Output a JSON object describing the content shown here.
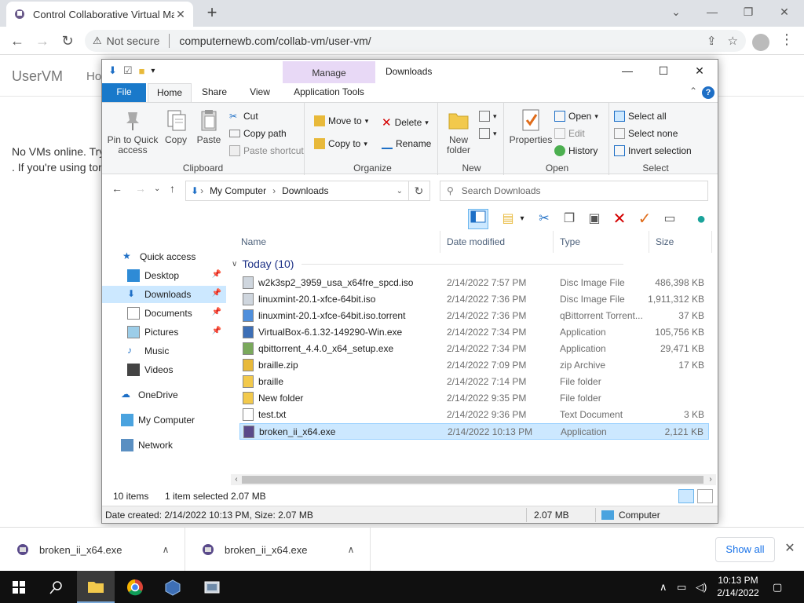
{
  "browser": {
    "tab_title": "Control Collaborative Virtual Ma",
    "security_label": "Not secure",
    "url": "computernewb.com/collab-vm/user-vm/"
  },
  "webpage": {
    "brand": "UserVM",
    "nav_link": "Ho",
    "message_line1": "No VMs online. Try",
    "message_line2": ". If you're using tor"
  },
  "explorer": {
    "window_title": "Downloads",
    "manage_label": "Manage",
    "tabs": {
      "file": "File",
      "home": "Home",
      "share": "Share",
      "view": "View",
      "app_tools": "Application Tools"
    },
    "ribbon": {
      "clipboard": {
        "label": "Clipboard",
        "pin": "Pin to Quick access",
        "copy": "Copy",
        "paste": "Paste",
        "cut": "Cut",
        "copy_path": "Copy path",
        "paste_shortcut": "Paste shortcut"
      },
      "organize": {
        "label": "Organize",
        "move_to": "Move to",
        "copy_to": "Copy to",
        "delete": "Delete",
        "rename": "Rename"
      },
      "new": {
        "label": "New",
        "new_folder": "New folder"
      },
      "open": {
        "label": "Open",
        "properties": "Properties",
        "open": "Open",
        "edit": "Edit",
        "history": "History"
      },
      "select": {
        "label": "Select",
        "select_all": "Select all",
        "select_none": "Select none",
        "invert": "Invert selection"
      }
    },
    "address": {
      "crumb1": "My Computer",
      "crumb2": "Downloads",
      "search_placeholder": "Search Downloads"
    },
    "nav": {
      "quick_access": "Quick access",
      "desktop": "Desktop",
      "downloads": "Downloads",
      "documents": "Documents",
      "pictures": "Pictures",
      "music": "Music",
      "videos": "Videos",
      "onedrive": "OneDrive",
      "my_computer": "My Computer",
      "network": "Network"
    },
    "columns": {
      "name": "Name",
      "date": "Date modified",
      "type": "Type",
      "size": "Size"
    },
    "group_header": "Today (10)",
    "files": [
      {
        "name": "w2k3sp2_3959_usa_x64fre_spcd.iso",
        "date": "2/14/2022 7:57 PM",
        "type": "Disc Image File",
        "size": "486,398 KB",
        "icon": "disc-image-icon"
      },
      {
        "name": "linuxmint-20.1-xfce-64bit.iso",
        "date": "2/14/2022 7:36 PM",
        "type": "Disc Image File",
        "size": "1,911,312 KB",
        "icon": "disc-image-icon"
      },
      {
        "name": "linuxmint-20.1-xfce-64bit.iso.torrent",
        "date": "2/14/2022 7:36 PM",
        "type": "qBittorrent Torrent...",
        "size": "37 KB",
        "icon": "torrent-icon"
      },
      {
        "name": "VirtualBox-6.1.32-149290-Win.exe",
        "date": "2/14/2022 7:34 PM",
        "type": "Application",
        "size": "105,756 KB",
        "icon": "virtualbox-icon"
      },
      {
        "name": "qbittorrent_4.4.0_x64_setup.exe",
        "date": "2/14/2022 7:34 PM",
        "type": "Application",
        "size": "29,471 KB",
        "icon": "installer-icon"
      },
      {
        "name": "braille.zip",
        "date": "2/14/2022 7:09 PM",
        "type": "zip Archive",
        "size": "17 KB",
        "icon": "zip-icon"
      },
      {
        "name": "braille",
        "date": "2/14/2022 7:14 PM",
        "type": "File folder",
        "size": "",
        "icon": "folder-icon"
      },
      {
        "name": "New folder",
        "date": "2/14/2022 9:35 PM",
        "type": "File folder",
        "size": "",
        "icon": "folder-icon"
      },
      {
        "name": "test.txt",
        "date": "2/14/2022 9:36 PM",
        "type": "Text Document",
        "size": "3 KB",
        "icon": "text-file-icon"
      },
      {
        "name": "broken_ii_x64.exe",
        "date": "2/14/2022 10:13 PM",
        "type": "Application",
        "size": "2,121 KB",
        "icon": "app-icon"
      }
    ],
    "status": {
      "count": "10 items",
      "selected": "1 item selected",
      "selected_size": "2.07 MB"
    },
    "details": {
      "info": "Date created: 2/14/2022 10:13 PM, Size: 2.07 MB",
      "size": "2.07 MB",
      "location": "Computer"
    }
  },
  "downloads_bar": {
    "item1": "broken_ii_x64.exe",
    "item2": "broken_ii_x64.exe",
    "show_all": "Show all"
  },
  "taskbar": {
    "time": "10:13 PM",
    "date": "2/14/2022"
  },
  "colors": {
    "accent": "#1979ca",
    "manage": "#e8d9f6",
    "selection": "#cce8ff",
    "group_header": "#1e3287"
  }
}
